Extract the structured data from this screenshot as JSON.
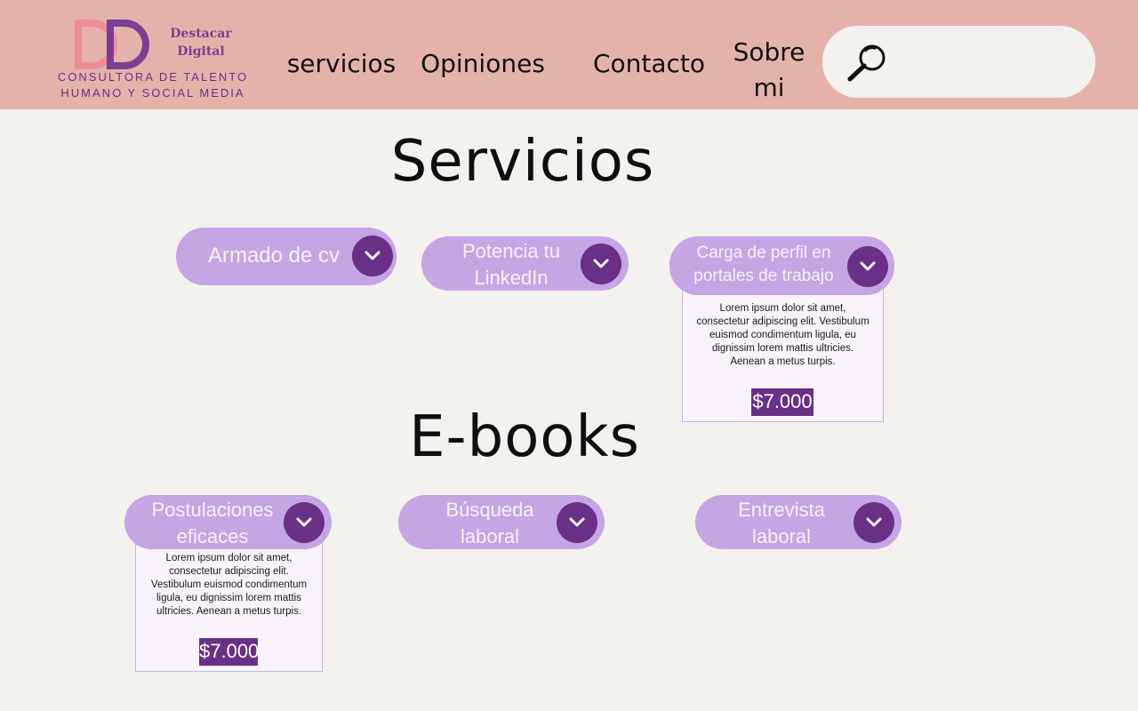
{
  "header": {
    "logo": {
      "letters": "DD",
      "name": "Destacar Digital",
      "tagline": "CONSULTORA DE TALENTO\nHUMANO Y SOCIAL MEDIA"
    },
    "nav": {
      "servicios": "servicios",
      "opiniones": "Opiniones",
      "contacto": "Contacto",
      "sobre": "Sobre\nmi"
    },
    "search": {
      "placeholder": "",
      "value": "",
      "icon": "search-icon"
    }
  },
  "servicios": {
    "title": "Servicios",
    "items": [
      {
        "label": "Armado de cv"
      },
      {
        "label": "Potencia tu LinkedIn"
      },
      {
        "label": "Carga de perfil en portales de trabajo",
        "description": "Lorem ipsum dolor sit amet, consectetur adipiscing elit. Vestibulum euismod condimentum ligula, eu dignissim lorem mattis ultricies. Aenean a metus turpis.",
        "price": "$7.000"
      }
    ]
  },
  "ebooks": {
    "title": "E-books",
    "items": [
      {
        "label": "Postulaciones eficaces",
        "description": "Lorem ipsum dolor sit amet, consectetur adipiscing elit. Vestibulum euismod condimentum ligula, eu dignissim lorem mattis ultricies. Aenean a metus turpis.",
        "price": "$7.000"
      },
      {
        "label": "Búsqueda laboral"
      },
      {
        "label": "Entrevista laboral"
      }
    ]
  },
  "colors": {
    "header_bg": "#e5b2ab",
    "page_bg": "#f4f2ef",
    "pill": "#c4a6e4",
    "accent": "#6a2f87",
    "logo_pink": "#ef8d9b"
  }
}
